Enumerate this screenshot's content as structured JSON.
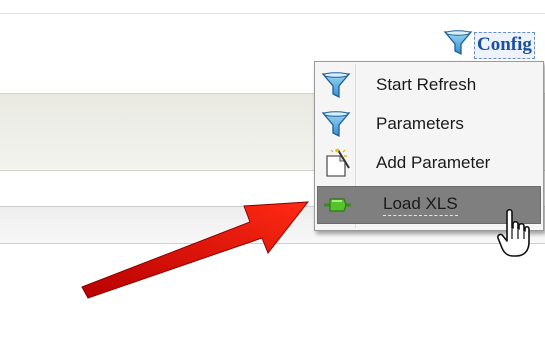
{
  "config": {
    "label": "Config",
    "icon": "filter-funnel-icon"
  },
  "menu": {
    "items": [
      {
        "label": "Start Refresh",
        "icon": "filter-funnel-icon"
      },
      {
        "label": "Parameters",
        "icon": "filter-funnel-icon"
      },
      {
        "label": "Add Parameter",
        "icon": "new-page-icon"
      },
      {
        "label": "Load XLS",
        "icon": "green-plugin-icon",
        "highlighted": true
      }
    ]
  },
  "colors": {
    "config_text": "#1a4fa5",
    "menu_highlight": "#7f7f7f",
    "arrow": "#e60000"
  }
}
